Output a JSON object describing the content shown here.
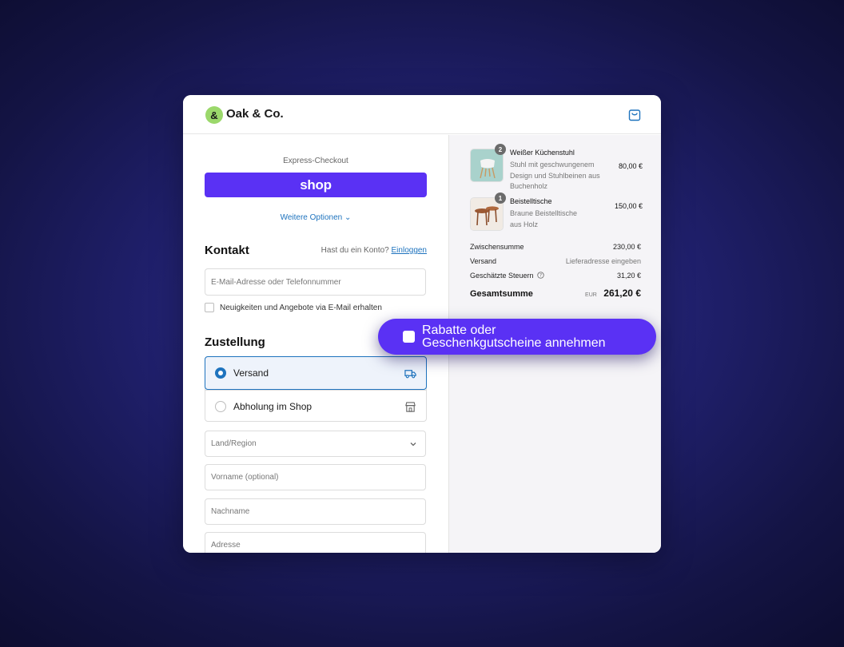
{
  "brand": {
    "logo_char": "&",
    "name": "Oak & Co."
  },
  "checkout": {
    "express_label": "Express-Checkout",
    "shop_button": "shop",
    "more_options": "Weitere Optionen"
  },
  "contact": {
    "title": "Kontakt",
    "account_question": "Hast du ein Konto?",
    "login_link": "Einloggen",
    "email_placeholder": "E-Mail-Adresse oder Telefonnummer",
    "newsletter_label": "Neuigkeiten und Angebote via E-Mail erhalten"
  },
  "delivery": {
    "title": "Zustellung",
    "options": [
      {
        "label": "Versand",
        "selected": true,
        "icon": "truck-icon"
      },
      {
        "label": "Abholung im Shop",
        "selected": false,
        "icon": "store-icon"
      }
    ],
    "country_placeholder": "Land/Region",
    "firstname_placeholder": "Vorname (optional)",
    "lastname_placeholder": "Nachname",
    "address_placeholder": "Adresse"
  },
  "order": {
    "items": [
      {
        "qty": "2",
        "name": "Weißer Küchenstuhl",
        "description": "Stuhl mit geschwungenem Design und Stuhlbeinen aus Buchenholz",
        "price": "80,00 €"
      },
      {
        "qty": "1",
        "name": "Beistelltische",
        "description": "Braune Beistelltische aus Holz",
        "price": "150,00 €"
      }
    ],
    "subtotal_label": "Zwischensumme",
    "subtotal_value": "230,00 €",
    "shipping_label": "Versand",
    "shipping_value": "Lieferadresse eingeben",
    "tax_label": "Geschätzte Steuern",
    "tax_value": "31,20 €",
    "total_label": "Gesamtsumme",
    "total_currency": "EUR",
    "total_value": "261,20 €"
  },
  "promo": {
    "line1": "Rabatte oder",
    "line2": "Geschenkgutscheine annehmen"
  },
  "colors": {
    "accent": "#5a31f4",
    "link": "#1e73be",
    "background": "#1f1f6a"
  }
}
